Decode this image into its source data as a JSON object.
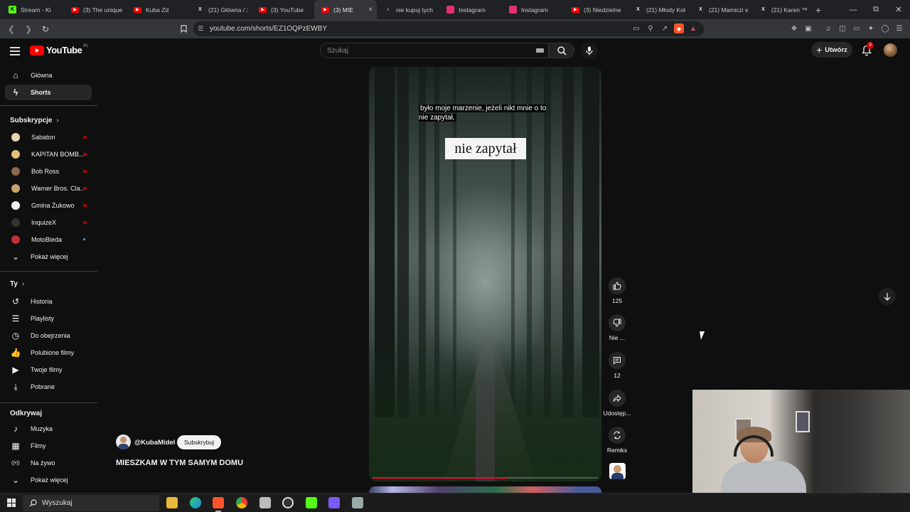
{
  "browser": {
    "tabs": [
      {
        "title": "Stream - Ki",
        "icon": "kick-icon",
        "color": "#53fc18"
      },
      {
        "title": "(3) The unique",
        "icon": "youtube-icon",
        "color": "#ff0000"
      },
      {
        "title": "Kuba Zd",
        "icon": "youtube-icon",
        "color": "#ff0000"
      },
      {
        "title": "(21) Główna / X",
        "icon": "x-icon",
        "color": "#000000"
      },
      {
        "title": "(3) YouTube",
        "icon": "youtube-icon",
        "color": "#ff0000"
      },
      {
        "title": "(3) MIE",
        "icon": "youtube-icon",
        "color": "#ff0000",
        "active": true
      },
      {
        "title": "nie kupuj tych",
        "icon": "tiktok-icon",
        "color": "#111111"
      },
      {
        "title": "Instagram",
        "icon": "instagram-icon",
        "color": "#e1306c"
      },
      {
        "title": "Instagram",
        "icon": "instagram-icon",
        "color": "#e1306c"
      },
      {
        "title": "(3) Niedzielne",
        "icon": "youtube-icon",
        "color": "#ff0000"
      },
      {
        "title": "(21) Młody Koł",
        "icon": "x-icon",
        "color": "#000000"
      },
      {
        "title": "(21) Mamiczi w",
        "icon": "x-icon",
        "color": "#000000"
      },
      {
        "title": "(21) Karen ™",
        "icon": "x-icon",
        "color": "#000000"
      }
    ],
    "url": "youtube.com/shorts/EZ1OQPzEWBY"
  },
  "header": {
    "logo_text": "YouTube",
    "logo_region": "PL",
    "search_placeholder": "Szukaj",
    "create_label": "Utwórz",
    "notification_count": "3"
  },
  "sidebar": {
    "main": [
      {
        "label": "Główna",
        "icon": "home-icon"
      },
      {
        "label": "Shorts",
        "icon": "shorts-icon",
        "active": true
      }
    ],
    "subscriptions_title": "Subskrypcje",
    "subscriptions": [
      {
        "label": "Sabaton",
        "color": "#e6d6b0",
        "status": "live"
      },
      {
        "label": "KAPITAN BOMB...",
        "color": "#e0c27a",
        "status": "live"
      },
      {
        "label": "Bob Ross",
        "color": "#8a6a4a",
        "status": "live"
      },
      {
        "label": "Warner Bros. Cla...",
        "color": "#c9a36b",
        "status": "live"
      },
      {
        "label": "Gmina Żukowo",
        "color": "#f0f0f0",
        "status": "live"
      },
      {
        "label": "InquizeX",
        "color": "#333333",
        "status": "live"
      },
      {
        "label": "MotoBieda",
        "color": "#c03030",
        "status": "new"
      }
    ],
    "subs_more": "Pokaż więcej",
    "you_title": "Ty",
    "you": [
      {
        "label": "Historia",
        "icon": "history-icon"
      },
      {
        "label": "Playlisty",
        "icon": "playlist-icon"
      },
      {
        "label": "Do obejrzenia",
        "icon": "clock-icon"
      },
      {
        "label": "Polubione filmy",
        "icon": "like-icon"
      },
      {
        "label": "Twoje filmy",
        "icon": "video-icon"
      },
      {
        "label": "Pobrane",
        "icon": "download-icon"
      }
    ],
    "explore_title": "Odkrywaj",
    "explore": [
      {
        "label": "Muzyka",
        "icon": "music-icon"
      },
      {
        "label": "Filmy",
        "icon": "film-icon"
      },
      {
        "label": "Na żywo",
        "icon": "live-icon"
      }
    ],
    "explore_more": "Pokaż więcej"
  },
  "short": {
    "caption_line": "było moje marzenie, jeżeli nikt mnie o to nie zapytał,",
    "caption_word": "nie zapytał",
    "progress": 0.6,
    "channel": "@KubaMidel",
    "subscribe_label": "Subskrybuj",
    "title": "MIESZKAM W TYM SAMYM DOMU",
    "actions": {
      "likes": "125",
      "dislike": "Nie ...",
      "comments": "12",
      "share": "Udostęp...",
      "remix": "Remiks"
    }
  },
  "taskbar": {
    "search_label": "Wyszukaj"
  }
}
